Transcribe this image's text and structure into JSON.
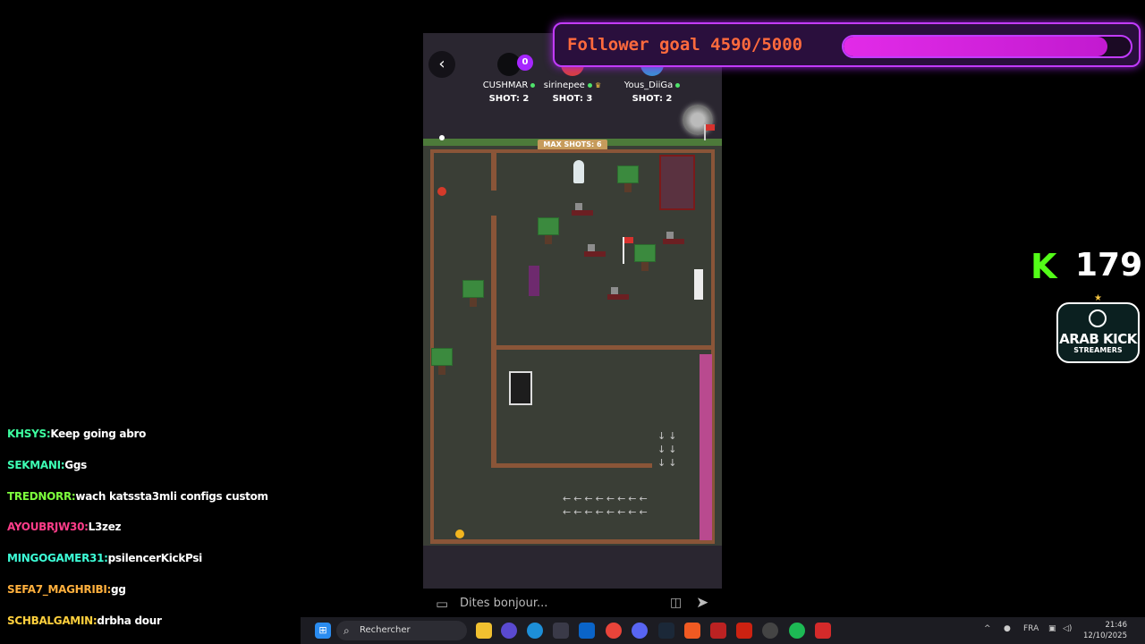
{
  "game": {
    "back_icon": "chevron-left-icon",
    "players": [
      {
        "name": "CUSHMAR",
        "shots_label": "SHOT: 2",
        "badge": "0"
      },
      {
        "name": "sirinepee",
        "shots_label": "SHOT: 3"
      },
      {
        "name": "Yous_DiiGa",
        "shots_label": "SHOT: 2"
      }
    ],
    "max_shots": "MAX SHOTS: 6",
    "chat_placeholder": "Dites bonjour..."
  },
  "overlay": {
    "follower_goal_text": "Follower goal 4590/5000",
    "follower_progress": 0.918,
    "kick_count": "179",
    "badge_title": "ARAB KICK",
    "badge_subtitle": "STREAMERS"
  },
  "chat": [
    {
      "user": "KHSYS:",
      "text": "Keep going abro",
      "color": "#3dffa0"
    },
    {
      "user": "SEKMANI:",
      "text": "Ggs",
      "color": "#3dffb4"
    },
    {
      "user": "TREDNORR:",
      "text": "wach katssta3mli configs custom",
      "color": "#7dff3d"
    },
    {
      "user": "AYOUBRJW30:",
      "text": "L3zez",
      "color": "#ff3d8a"
    },
    {
      "user": "MINGOGAMER31:",
      "text": "psilencerKickPsi",
      "color": "#3dffd8"
    },
    {
      "user": "SEFA7_MAGHRIBI:",
      "text": "gg",
      "color": "#ffb03d"
    },
    {
      "user": "SCHBALGAMIN:",
      "text": "drbha dour",
      "color": "#ffd03d"
    }
  ],
  "taskbar": {
    "search_label": "Rechercher",
    "language": "FRA",
    "time": "21:46",
    "date": "12/10/2025"
  },
  "colors": {
    "accent": "#c23bff",
    "kick_green": "#53fc18",
    "goal_text": "#ff6a3d"
  }
}
